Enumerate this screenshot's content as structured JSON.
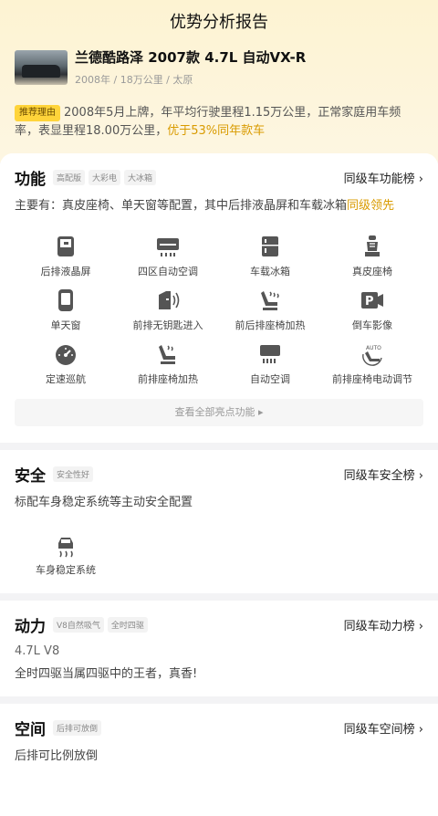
{
  "page": {
    "title": "优势分析报告"
  },
  "car": {
    "name": "兰德酷路泽 2007款 4.7L 自动VX-R",
    "meta": "2008年 / 18万公里 / 太原"
  },
  "reason": {
    "tag": "推荐理由",
    "text": "2008年5月上牌，年平均行驶里程1.15万公里，正常家庭用车频率，表显里程18.00万公里，",
    "highlight": "优于53%同年款车"
  },
  "features": {
    "title": "功能",
    "chips": [
      "高配版",
      "大彩电",
      "大冰箱"
    ],
    "rank": "同级车功能榜 ›",
    "desc": "主要有：真皮座椅、单天窗等配置，其中后排液晶屏和车载冰箱",
    "desc_highlight": "同级领先",
    "items": [
      {
        "label": "后排液晶屏",
        "icon": "rear-screen-icon"
      },
      {
        "label": "四区自动空调",
        "icon": "ac-icon"
      },
      {
        "label": "车载冰箱",
        "icon": "fridge-icon"
      },
      {
        "label": "真皮座椅",
        "icon": "leather-seat-icon"
      },
      {
        "label": "单天窗",
        "icon": "sunroof-icon"
      },
      {
        "label": "前排无钥匙进入",
        "icon": "keyless-icon"
      },
      {
        "label": "前后排座椅加热",
        "icon": "seat-heat-icon"
      },
      {
        "label": "倒车影像",
        "icon": "parking-camera-icon"
      },
      {
        "label": "定速巡航",
        "icon": "cruise-icon"
      },
      {
        "label": "前排座椅加热",
        "icon": "seat-heat-icon"
      },
      {
        "label": "自动空调",
        "icon": "ac-icon"
      },
      {
        "label": "前排座椅电动调节",
        "icon": "auto-seat-icon"
      }
    ],
    "view_all": "查看全部亮点功能 ▸"
  },
  "safety": {
    "title": "安全",
    "chips": [
      "安全性好"
    ],
    "rank": "同级车安全榜 ›",
    "desc": "标配车身稳定系统等主动安全配置",
    "items": [
      {
        "label": "车身稳定系统",
        "icon": "stability-icon"
      }
    ]
  },
  "power": {
    "title": "动力",
    "chips": [
      "V8自然吸气",
      "全时四驱"
    ],
    "rank": "同级车动力榜 ›",
    "engine": "4.7L V8",
    "desc": "全时四驱当属四驱中的王者，真香!"
  },
  "space": {
    "title": "空间",
    "chips": [
      "后排可放倒"
    ],
    "rank": "同级车空间榜 ›",
    "desc": "后排可比例放倒"
  }
}
